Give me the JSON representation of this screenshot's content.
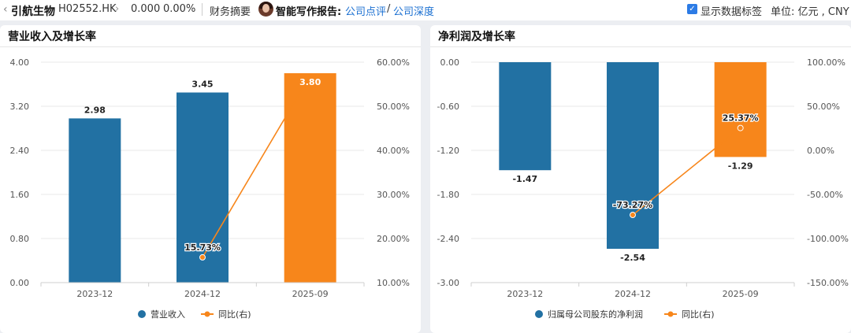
{
  "header": {
    "back_icon": "chevron-left-icon",
    "stock_name": "引航生物",
    "stock_code": "H02552.HK",
    "chevron": "›",
    "price": "0.000",
    "change_pct": "0.00%",
    "fin_summary": "财务摘要",
    "ai_report_label": "智能写作报告:",
    "link_review": "公司点评",
    "link_sep": "/",
    "link_depth": "公司深度",
    "show_labels": "显示数据标签",
    "show_labels_checked": true,
    "unit": "单位: 亿元 , CNY"
  },
  "colors": {
    "bar": "#2271a3",
    "highlight": "#f7861b",
    "line": "#f7861b",
    "grid": "#e8e8e8",
    "text": "#555555"
  },
  "chart_data": [
    {
      "type": "bar",
      "title": "营业收入及增长率",
      "categories": [
        "2023-12",
        "2024-12",
        "2025-09"
      ],
      "series": [
        {
          "name": "营业收入",
          "values": [
            2.98,
            3.45,
            3.8
          ],
          "labels": [
            "2.98",
            "3.45",
            "3.80"
          ]
        },
        {
          "name": "同比(右)",
          "values": [
            null,
            15.73,
            57.0
          ],
          "labels": [
            "",
            "15.73%",
            ""
          ]
        }
      ],
      "left_axis": {
        "ticks": [
          "4.00",
          "3.20",
          "2.40",
          "1.60",
          "0.80",
          "0.00"
        ],
        "min": 0,
        "max": 4
      },
      "right_axis": {
        "ticks": [
          "60.00%",
          "50.00%",
          "40.00%",
          "30.00%",
          "20.00%",
          "10.00%"
        ],
        "min": 10,
        "max": 60
      },
      "legend": [
        "营业收入",
        "同比(右)"
      ],
      "legend_position": "bottom",
      "grid": true
    },
    {
      "type": "bar",
      "title": "净利润及增长率",
      "categories": [
        "2023-12",
        "2024-12",
        "2025-09"
      ],
      "series": [
        {
          "name": "归属母公司股东的净利润",
          "values": [
            -1.47,
            -2.54,
            -1.29
          ],
          "labels": [
            "-1.47",
            "-2.54",
            "-1.29"
          ]
        },
        {
          "name": "同比(右)",
          "values": [
            null,
            -73.27,
            25.37
          ],
          "labels": [
            "",
            "-73.27%",
            "25.37%"
          ]
        }
      ],
      "left_axis": {
        "ticks": [
          "0.00",
          "-0.60",
          "-1.20",
          "-1.80",
          "-2.40",
          "-3.00"
        ],
        "min": -3,
        "max": 0
      },
      "right_axis": {
        "ticks": [
          "100.00%",
          "50.00%",
          "0.00%",
          "-50.00%",
          "-100.00%",
          "-150.00%"
        ],
        "min": -150,
        "max": 100
      },
      "legend": [
        "归属母公司股东的净利润",
        "同比(右)"
      ],
      "legend_position": "bottom",
      "grid": true
    }
  ]
}
